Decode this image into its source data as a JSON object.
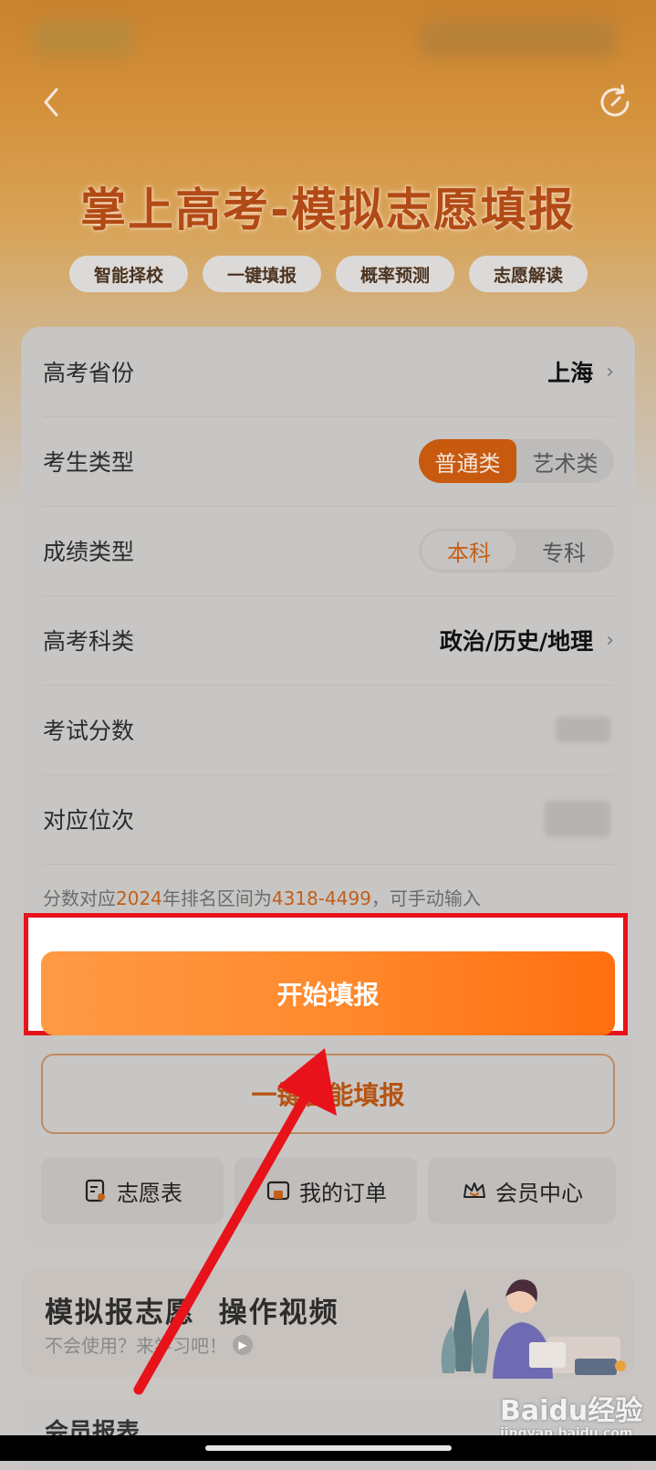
{
  "header": {
    "title": "掌上高考-模拟志愿填报",
    "chips": [
      "智能择校",
      "一键填报",
      "概率预测",
      "志愿解读"
    ]
  },
  "form": {
    "province": {
      "label": "高考省份",
      "value": "上海"
    },
    "student_type": {
      "label": "考生类型",
      "options": [
        "普通类",
        "艺术类"
      ],
      "selected": "普通类"
    },
    "score_type": {
      "label": "成绩类型",
      "options": [
        "本科",
        "专科"
      ],
      "selected": "本科"
    },
    "subjects": {
      "label": "高考科类",
      "value": "政治/历史/地理"
    },
    "exam_score": {
      "label": "考试分数"
    },
    "rank": {
      "label": "对应位次"
    },
    "hint": {
      "prefix": "分数对应",
      "year": "2024",
      "middle": "年排名区间为",
      "range": "4318-4499",
      "suffix": "，可手动输入"
    }
  },
  "actions": {
    "start_label": "开始填报",
    "smart_label": "一键智能填报",
    "tiles": [
      "志愿表",
      "我的订单",
      "会员中心"
    ]
  },
  "video": {
    "title": "模拟报志愿  操作视频",
    "subtitle": "不会使用？来学习吧！"
  },
  "member_section": {
    "label": "会员报表"
  },
  "watermark": {
    "main": "Baidu经验",
    "sub": "jingyan.baidu.com"
  },
  "colors": {
    "accent": "#ff7a1f",
    "highlight_frame": "#e8121b",
    "arrow": "#e8121b"
  }
}
